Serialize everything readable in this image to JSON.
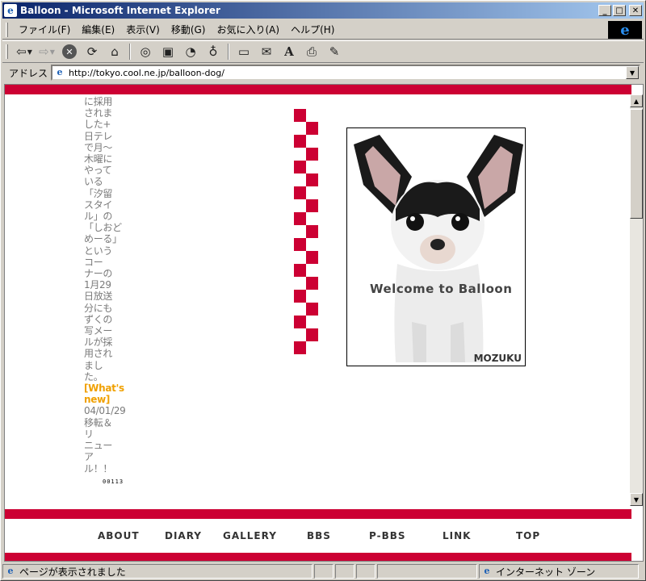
{
  "window": {
    "title": "Balloon - Microsoft Internet Explorer",
    "minimize_glyph": "_",
    "maximize_glyph": "□",
    "close_glyph": "✕"
  },
  "menu": {
    "items": [
      "ファイル(F)",
      "編集(E)",
      "表示(V)",
      "移動(G)",
      "お気に入り(A)",
      "ヘルプ(H)"
    ]
  },
  "toolbar": {
    "icons": [
      "back-icon",
      "forward-icon",
      "stop-icon",
      "refresh-icon",
      "home-icon",
      "search-icon",
      "favorites-icon",
      "history-icon",
      "channels-icon",
      "fullscreen-icon",
      "mail-icon",
      "font-icon",
      "print-icon",
      "edit-icon"
    ]
  },
  "address": {
    "label": "アドレス",
    "url": "http://tokyo.cool.ne.jp/balloon-dog/"
  },
  "sidebar_text": {
    "lines": [
      "に採用",
      "されま",
      "した+",
      "日テレ",
      "で月～",
      "木曜に",
      "やって",
      "いる",
      "「汐留",
      "スタイ",
      "ル」の",
      "「しおど",
      "めーる」",
      "という",
      "コー",
      "ナーの",
      "1月29",
      "日放送",
      "分にも",
      "ずくの",
      "写メー",
      "ルが採",
      "用され",
      "まし",
      "た。"
    ],
    "news_heading_1": "[What's",
    "news_heading_2": "new]",
    "news_lines": [
      "04/01/29",
      "移転＆",
      "リ",
      "ニュー",
      "ア",
      "ル！！"
    ],
    "counter": "00113"
  },
  "photo": {
    "caption": "Welcome to Balloon",
    "signature": "MOZUKU"
  },
  "footer_nav": {
    "about": "ABOUT",
    "diary": "DIARY",
    "gallery": "GALLERY",
    "bbs": "BBS",
    "pbbs": "P-BBS",
    "link": "LINK",
    "top": "TOP"
  },
  "status": {
    "text": "ページが表示されました",
    "zone": "インターネット ゾーン"
  },
  "colors": {
    "accent_red": "#cc0033",
    "news_orange": "#f0a000",
    "title_bar": "#0a246a"
  }
}
